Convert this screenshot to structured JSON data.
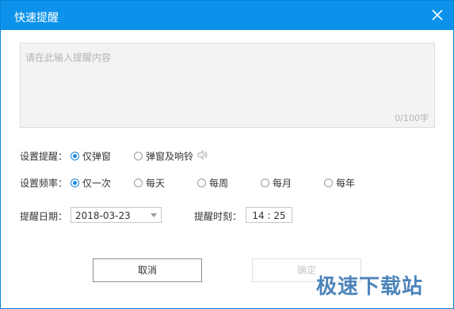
{
  "window": {
    "title": "快速提醒"
  },
  "content_input": {
    "placeholder": "请在此输入提醒内容",
    "counter": "0/100字"
  },
  "reminder": {
    "label": "设置提醒：",
    "options": [
      "仅弹窗",
      "弹窗及响铃"
    ],
    "selected": "仅弹窗"
  },
  "frequency": {
    "label": "设置频率：",
    "options": [
      "仅一次",
      "每天",
      "每周",
      "每月",
      "每年"
    ],
    "selected": "仅一次"
  },
  "date": {
    "label": "提醒日期：",
    "value": "2018-03-23"
  },
  "time": {
    "label": "提醒时刻：",
    "value": "14 : 25"
  },
  "buttons": {
    "cancel": "取消",
    "ok": "确定"
  },
  "watermark": "极速下载站",
  "colors": {
    "titlebar": "#0c92ea",
    "radio_accent": "#1c88d8"
  }
}
